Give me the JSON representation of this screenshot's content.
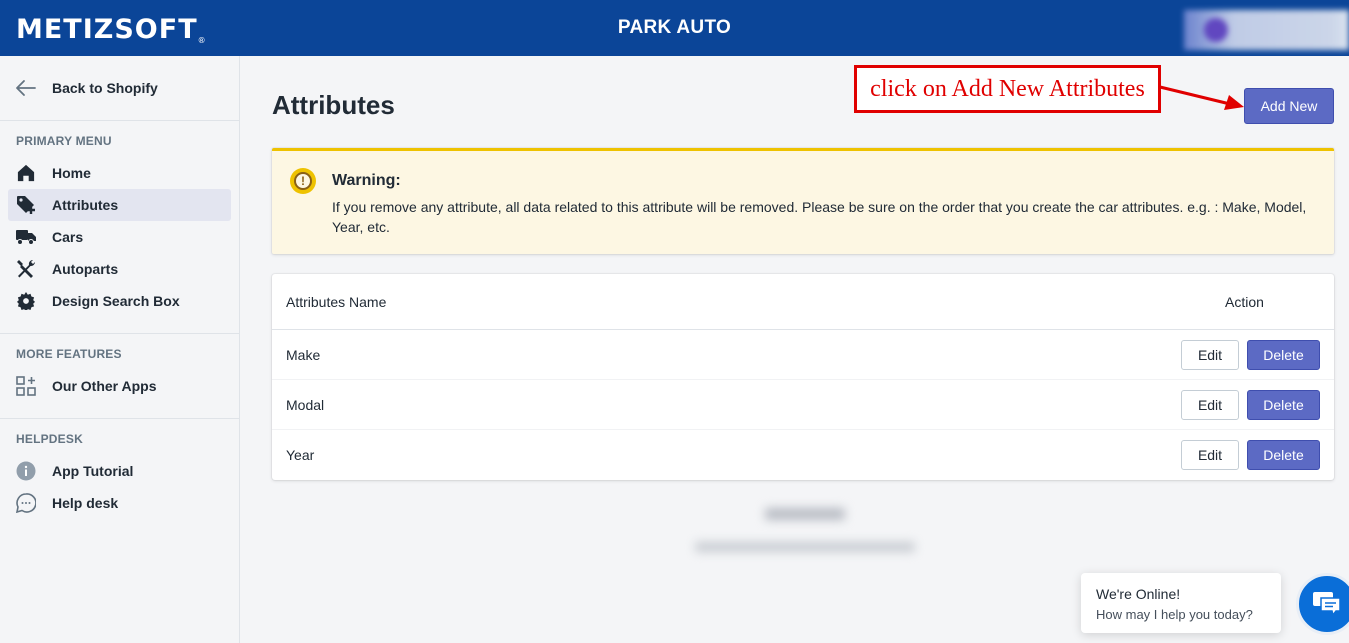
{
  "header": {
    "logo": "METIZSOFT",
    "logo_mark": "®",
    "store_title": "PARK AUTO"
  },
  "sidebar": {
    "back_label": "Back to Shopify",
    "sections": {
      "primary": "PRIMARY MENU",
      "more": "MORE FEATURES",
      "help": "HELPDESK"
    },
    "items": {
      "home": "Home",
      "attributes": "Attributes",
      "cars": "Cars",
      "autoparts": "Autoparts",
      "design": "Design Search Box",
      "other_apps": "Our Other Apps",
      "tutorial": "App Tutorial",
      "helpdesk": "Help desk"
    },
    "active_item": "Attributes"
  },
  "main": {
    "title": "Attributes",
    "add_button": "Add New",
    "annotation": "click on Add New Attributes",
    "warning": {
      "title": "Warning:",
      "body": "If you remove any attribute, all data related to this attribute will be removed. Please be sure on the order that you create the car attributes. e.g. : Make, Model, Year, etc."
    },
    "table": {
      "headers": {
        "name": "Attributes Name",
        "action": "Action"
      },
      "rows": [
        {
          "name": "Make"
        },
        {
          "name": "Modal"
        },
        {
          "name": "Year"
        }
      ],
      "edit_label": "Edit",
      "delete_label": "Delete"
    }
  },
  "chat": {
    "line1": "We're Online!",
    "line2": "How may I help you today?"
  },
  "colors": {
    "header_bg": "#0b4598",
    "primary_button": "#5c6ac4",
    "warning_accent": "#eec200",
    "annotation_red": "#e00000",
    "chat_blue": "#0a6ed8"
  }
}
